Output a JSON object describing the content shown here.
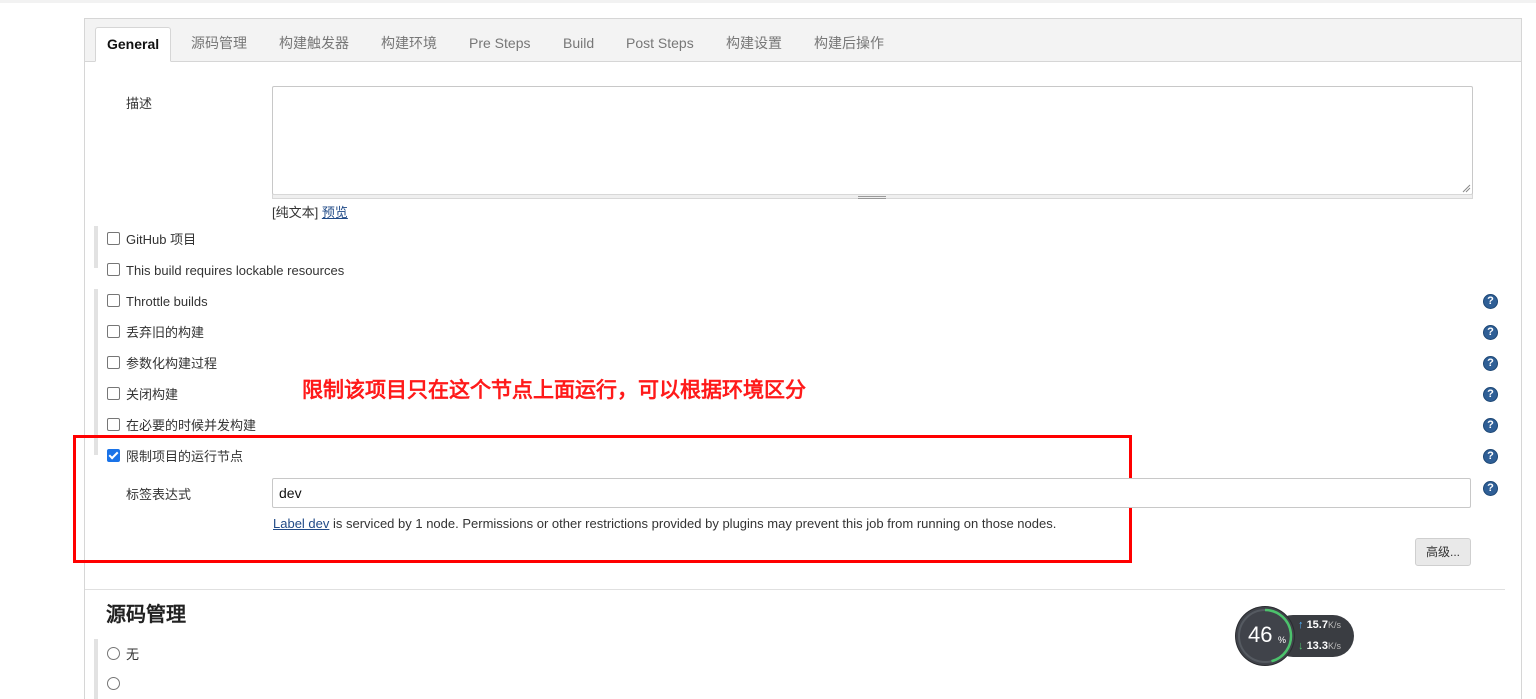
{
  "tabs": [
    {
      "label": "General",
      "active": true
    },
    {
      "label": "源码管理",
      "active": false
    },
    {
      "label": "构建触发器",
      "active": false
    },
    {
      "label": "构建环境",
      "active": false
    },
    {
      "label": "Pre Steps",
      "active": false
    },
    {
      "label": "Build",
      "active": false
    },
    {
      "label": "Post Steps",
      "active": false
    },
    {
      "label": "构建设置",
      "active": false
    },
    {
      "label": "构建后操作",
      "active": false
    }
  ],
  "description": {
    "label": "描述",
    "value": "",
    "format_prefix": "[纯文本]",
    "preview_link": "预览"
  },
  "options": [
    {
      "label": "GitHub 项目",
      "checked": false
    },
    {
      "label": "This build requires lockable resources",
      "checked": false
    },
    {
      "label": "Throttle builds",
      "checked": false
    },
    {
      "label": "丢弃旧的构建",
      "checked": false
    },
    {
      "label": "参数化构建过程",
      "checked": false
    },
    {
      "label": "关闭构建",
      "checked": false
    },
    {
      "label": "在必要的时候并发构建",
      "checked": false
    },
    {
      "label": "限制项目的运行节点",
      "checked": true
    }
  ],
  "annotation": "限制该项目只在这个节点上面运行，可以根据环境区分",
  "label_expression": {
    "label": "标签表达式",
    "value": "dev",
    "info_link": "Label dev",
    "info_text": " is serviced by 1 node. Permissions or other restrictions provided by plugins may prevent this job from running on those nodes."
  },
  "advanced_button": "高级...",
  "scm_section": {
    "title": "源码管理",
    "option_none": "无"
  },
  "speed_widget": {
    "percent": "46",
    "percent_unit": "%",
    "upload": "15.7",
    "download": "13.3",
    "unit": "K/s",
    "ring_color": "#4cc26c",
    "upload_arrow_color": "#4fb3ff",
    "download_arrow_color": "#4cc26c"
  },
  "colors": {
    "annotation_red": "#ff1a1a",
    "link_blue": "#204a87",
    "help_icon_blue": "#2f5f96",
    "checkbox_checked": "#1a73e8"
  }
}
